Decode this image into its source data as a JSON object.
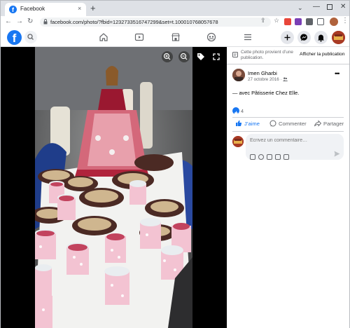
{
  "browser": {
    "tab_title": "Facebook",
    "tab_close": "×",
    "new_tab": "+",
    "tab_search": "⌄",
    "min": "—",
    "close": "✕",
    "back": "←",
    "forward": "→",
    "reload": "↻",
    "url": "facebook.com/photo/?fbid=1232733516747299&set=t.100010768057678",
    "share": "⇪",
    "bookmark": "☆",
    "menu": "⋮"
  },
  "facebook": {
    "logo": "f",
    "active_nav": "home"
  },
  "panel": {
    "notice_text": "Cette photo provient d’une publication.",
    "notice_link": "Afficher la publication",
    "author": "Imen Gharbi",
    "date": "27 octobre 2016 · ",
    "more": "•••",
    "caption": "— avec Pâtisserie Chez Elle.",
    "like_count": "4",
    "actions": {
      "like": "J’aime",
      "comment": "Commenter",
      "share": "Partager"
    },
    "comment_placeholder": "Écrivez un commentaire…"
  },
  "colors": {
    "fb_blue": "#1877f2",
    "text_secondary": "#65676b",
    "viewer_bg": "#000000"
  },
  "icons": [
    "zoom-in-icon",
    "zoom-out-icon",
    "tag-icon",
    "fullscreen-icon",
    "search-icon",
    "home-icon",
    "video-icon",
    "marketplace-icon",
    "groups-icon",
    "menu-icon",
    "create-icon",
    "messenger-icon",
    "notifications-icon",
    "globe-icon",
    "like-icon",
    "comment-icon",
    "share-icon",
    "send-icon"
  ]
}
